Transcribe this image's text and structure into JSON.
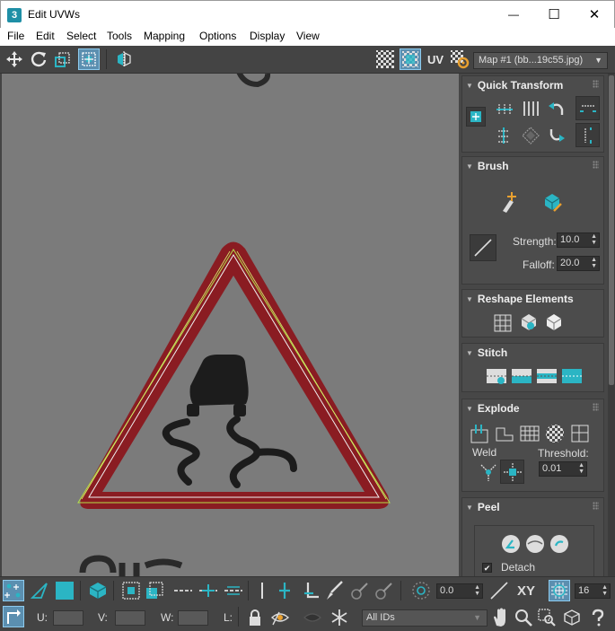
{
  "window": {
    "title": "Edit UVWs",
    "app_icon_text": "3",
    "minimize": "—",
    "maximize": "☐",
    "close": "✕"
  },
  "menu": [
    "File",
    "Edit",
    "Select",
    "Tools",
    "Mapping",
    "Options",
    "Display",
    "View"
  ],
  "toolbar": {
    "uv_label": "UV",
    "map_dropdown": "Map #1 (bb...19c55.jpg)"
  },
  "panels": {
    "quick_transform": "Quick Transform",
    "brush": {
      "title": "Brush",
      "strength_label": "Strength:",
      "strength_value": "10.0",
      "falloff_label": "Falloff:",
      "falloff_value": "20.0"
    },
    "reshape": "Reshape Elements",
    "stitch": "Stitch",
    "explode": {
      "title": "Explode",
      "weld_label": "Weld",
      "threshold_label": "Threshold:",
      "threshold_value": "0.01"
    },
    "peel": {
      "title": "Peel",
      "detach_label": "Detach",
      "detach_checked": true
    }
  },
  "bottom1": {
    "rotate_value": "0.0",
    "xy_label": "XY",
    "grid_value": "16"
  },
  "bottom2": {
    "u_label": "U:",
    "v_label": "V:",
    "w_label": "W:",
    "l_label": "L:",
    "ids_dropdown": "All IDs"
  },
  "colors": {
    "accent": "#2bb5c4",
    "active_button": "#5b8fb0",
    "sign_red": "#8c1c22",
    "uv_edge": "#b5e04a"
  }
}
